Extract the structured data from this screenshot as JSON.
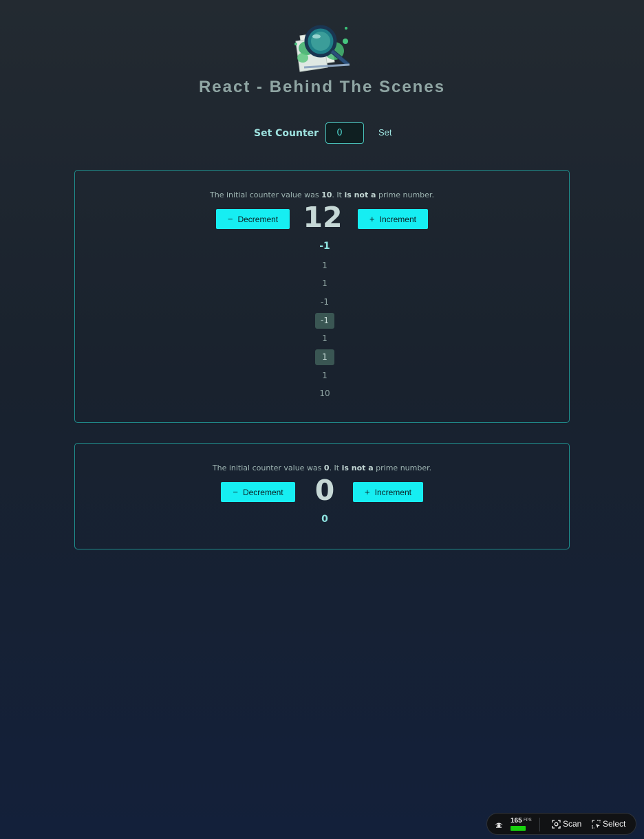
{
  "header": {
    "title": "React - Behind The Scenes"
  },
  "set_counter": {
    "label": "Set Counter",
    "input_value": "0",
    "button_label": "Set"
  },
  "counters": [
    {
      "info_prefix": "The initial counter value was ",
      "initial_value": "10",
      "info_middle": ". It ",
      "prime_status": "is not a",
      "info_suffix": " prime number.",
      "decrement_label": "Decrement",
      "increment_label": "Increment",
      "count": "12",
      "history": [
        {
          "value": "-1",
          "highlighted": false
        },
        {
          "value": "1",
          "highlighted": false
        },
        {
          "value": "1",
          "highlighted": false
        },
        {
          "value": "-1",
          "highlighted": false
        },
        {
          "value": "-1",
          "highlighted": true
        },
        {
          "value": "1",
          "highlighted": false
        },
        {
          "value": "1",
          "highlighted": true
        },
        {
          "value": "1",
          "highlighted": false
        },
        {
          "value": "10",
          "highlighted": false
        }
      ]
    },
    {
      "info_prefix": "The initial counter value was ",
      "initial_value": "0",
      "info_middle": ". It ",
      "prime_status": "is not a",
      "info_suffix": " prime number.",
      "decrement_label": "Decrement",
      "increment_label": "Increment",
      "count": "0",
      "history": [
        {
          "value": "0",
          "highlighted": false
        }
      ]
    }
  ],
  "devtools": {
    "fps_value": "165",
    "fps_unit": "FPS",
    "fps_level": 1.0,
    "scan_label": "Scan",
    "select_label": "Select"
  },
  "colors": {
    "accent": "#16eef2",
    "border": "#1f8c8b",
    "fps_bar": "#18d10e"
  },
  "icons": {
    "logo": "magnifier-over-map-logo",
    "decrement": "minus-icon",
    "increment": "plus-icon",
    "devtools_logo": "eye-icon",
    "scan": "scan-icon",
    "select": "select-cursor-icon"
  }
}
